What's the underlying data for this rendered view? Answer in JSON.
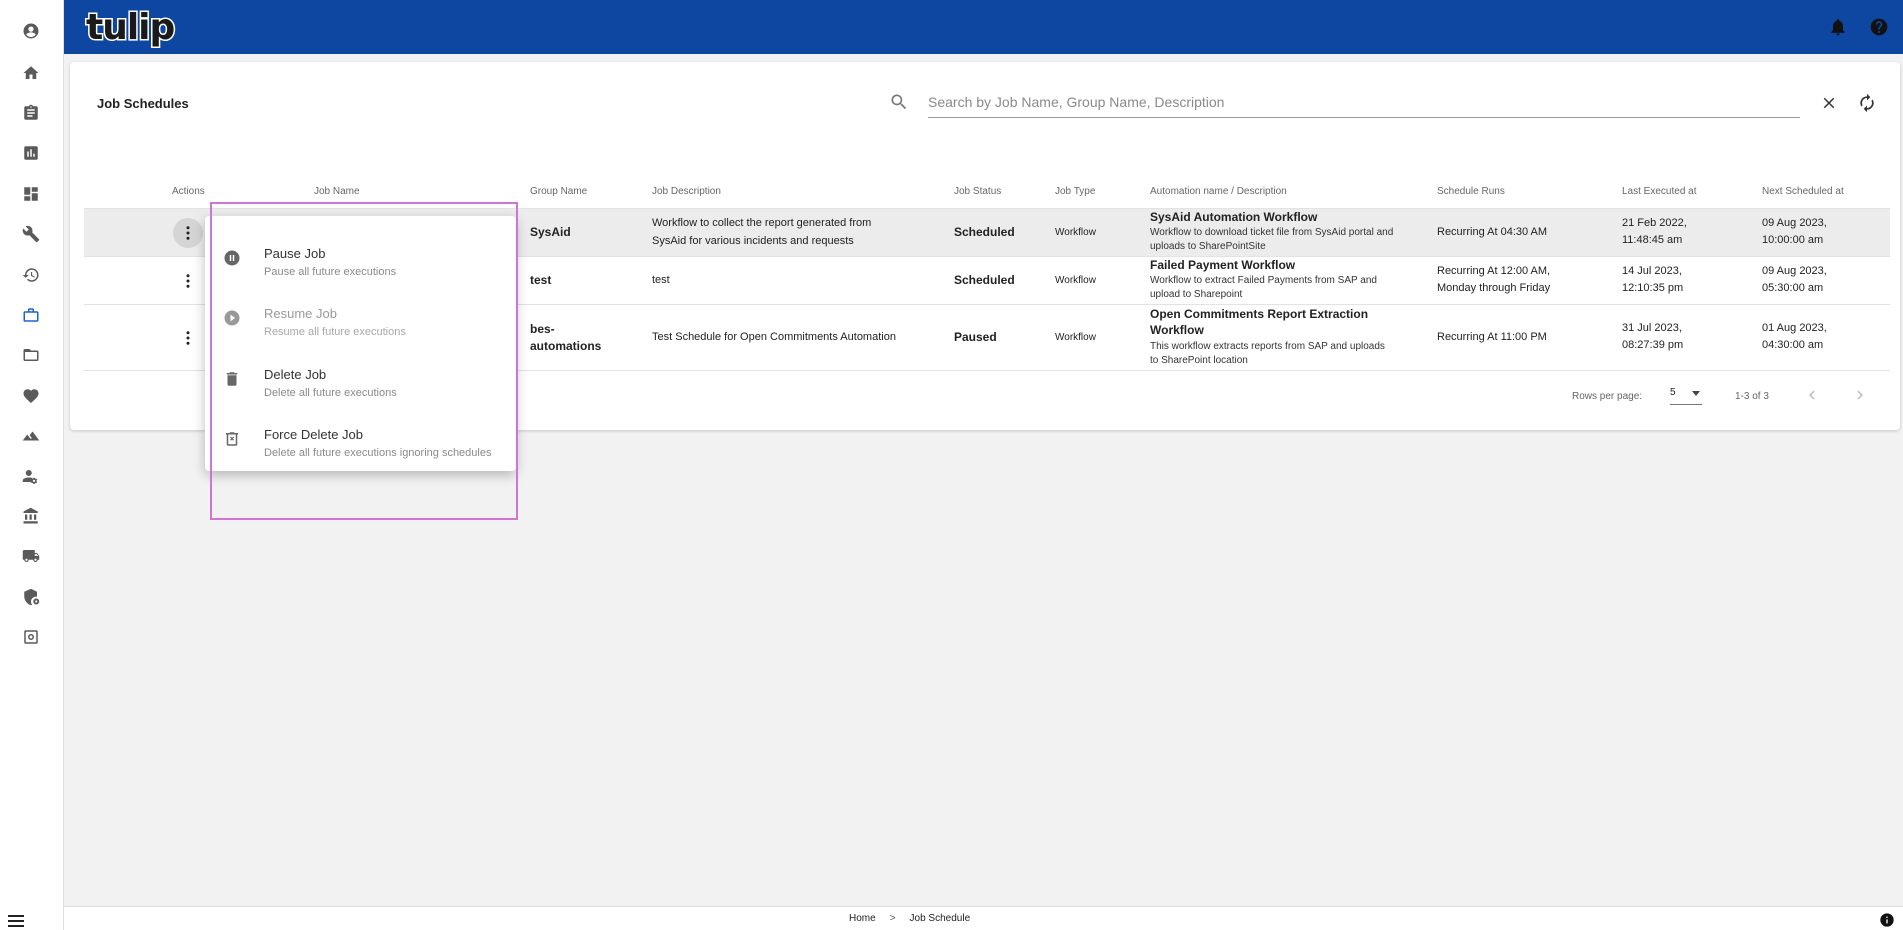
{
  "app": {
    "logo_text": "tulip",
    "brand_color": "#0d47a1",
    "accent_color": "#1e63c7"
  },
  "sidebar": {
    "icons": [
      "account-icon",
      "home-icon",
      "clipboard-icon",
      "chart-icon",
      "dashboard-icon",
      "wrench-icon",
      "history-icon",
      "briefcase-icon",
      "folder-icon",
      "heart-icon",
      "landscape-icon",
      "user-settings-icon",
      "bank-icon",
      "truck-icon",
      "shield-gear-icon",
      "settings-box-icon"
    ],
    "active": "briefcase-icon"
  },
  "page": {
    "title": "Job Schedules",
    "search_placeholder": "Search by Job Name, Group Name, Description"
  },
  "table": {
    "columns": {
      "actions": "Actions",
      "job_name": "Job Name",
      "group_name": "Group Name",
      "job_description": "Job Description",
      "job_status": "Job Status",
      "job_type": "Job Type",
      "automation": "Automation name / Description",
      "schedule_runs": "Schedule Runs",
      "last_executed": "Last Executed at",
      "next_scheduled": "Next Scheduled at"
    },
    "rows": [
      {
        "group_name": "SysAid",
        "job_description_1": "Workflow to collect the report generated from",
        "job_description_2": "SysAid for various incidents and requests",
        "job_status": "Scheduled",
        "job_type": "Workflow",
        "automation_name": "SysAid Automation Workflow",
        "automation_desc_1": "Workflow to download ticket file from SysAid portal and",
        "automation_desc_2": "uploads to SharePointSite",
        "schedule_runs_1": "Recurring At 04:30 AM",
        "schedule_runs_2": "",
        "last_executed_1": "21 Feb 2022,",
        "last_executed_2": "11:48:45 am",
        "next_scheduled_1": "09 Aug 2023,",
        "next_scheduled_2": "10:00:00 am"
      },
      {
        "group_name": "test",
        "job_description_1": "test",
        "job_description_2": "",
        "job_status": "Scheduled",
        "job_type": "Workflow",
        "automation_name": "Failed Payment Workflow",
        "automation_desc_1": "Workflow to extract Failed Payments from SAP and",
        "automation_desc_2": "upload to Sharepoint",
        "schedule_runs_1": "Recurring At 12:00 AM,",
        "schedule_runs_2": "Monday through Friday",
        "last_executed_1": "14 Jul 2023,",
        "last_executed_2": "12:10:35 pm",
        "next_scheduled_1": "09 Aug 2023,",
        "next_scheduled_2": "05:30:00 am"
      },
      {
        "group_name_1": "bes-",
        "group_name_2": "automations",
        "job_description_1": "Test Schedule for Open Commitments Automation",
        "job_description_2": "",
        "job_status": "Paused",
        "job_type": "Workflow",
        "automation_name_1": "Open Commitments Report Extraction",
        "automation_name_2": "Workflow",
        "automation_desc_1": "This workflow extracts reports from SAP and uploads",
        "automation_desc_2": "to SharePoint location",
        "schedule_runs_1": "Recurring At 11:00 PM",
        "schedule_runs_2": "",
        "last_executed_1": "31 Jul 2023,",
        "last_executed_2": "08:27:39 pm",
        "next_scheduled_1": "01 Aug 2023,",
        "next_scheduled_2": "04:30:00 am"
      }
    ],
    "pagination": {
      "rows_per_page_label": "Rows per page:",
      "rows_per_page": "5",
      "range": "1-3 of 3"
    }
  },
  "context_menu": {
    "items": [
      {
        "title": "Pause Job",
        "subtitle": "Pause all future executions",
        "icon": "pause-circle-icon",
        "disabled": false
      },
      {
        "title": "Resume Job",
        "subtitle": "Resume all future executions",
        "icon": "play-circle-icon",
        "disabled": true
      },
      {
        "title": "Delete Job",
        "subtitle": "Delete all future executions",
        "icon": "trash-icon",
        "disabled": false
      },
      {
        "title": "Force Delete Job",
        "subtitle": "Delete all future executions ignoring schedules",
        "icon": "force-delete-icon",
        "disabled": false
      }
    ]
  },
  "breadcrumb": {
    "home": "Home",
    "separator": ">",
    "current": "Job Schedule"
  }
}
